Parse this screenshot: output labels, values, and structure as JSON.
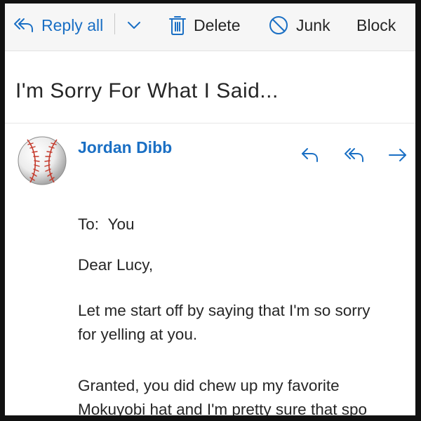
{
  "toolbar": {
    "reply_all_label": "Reply all",
    "delete_label": "Delete",
    "junk_label": "Junk",
    "block_label": "Block",
    "icons": [
      "reply-all-icon",
      "chevron-down-icon",
      "trash-icon",
      "prohibited-icon"
    ]
  },
  "message": {
    "subject": "I'm Sorry For What I Said...",
    "sender": "Jordan Dibb",
    "avatar": "baseball-avatar",
    "to_label": "To:",
    "to_value": "You",
    "greeting": "Dear Lucy,",
    "paragraph1_line1": "Let me start off by saying that I'm so sorry",
    "paragraph1_line2": "for yelling at you.",
    "paragraph2_line1": "Granted, you did chew up my favorite",
    "paragraph2_line2": "Mokuyobi hat and I'm pretty sure that spo"
  },
  "colors": {
    "accent": "#1a6fc4",
    "text": "#262626",
    "toolbar_bg": "#f6f6f6",
    "frame": "#111111"
  }
}
